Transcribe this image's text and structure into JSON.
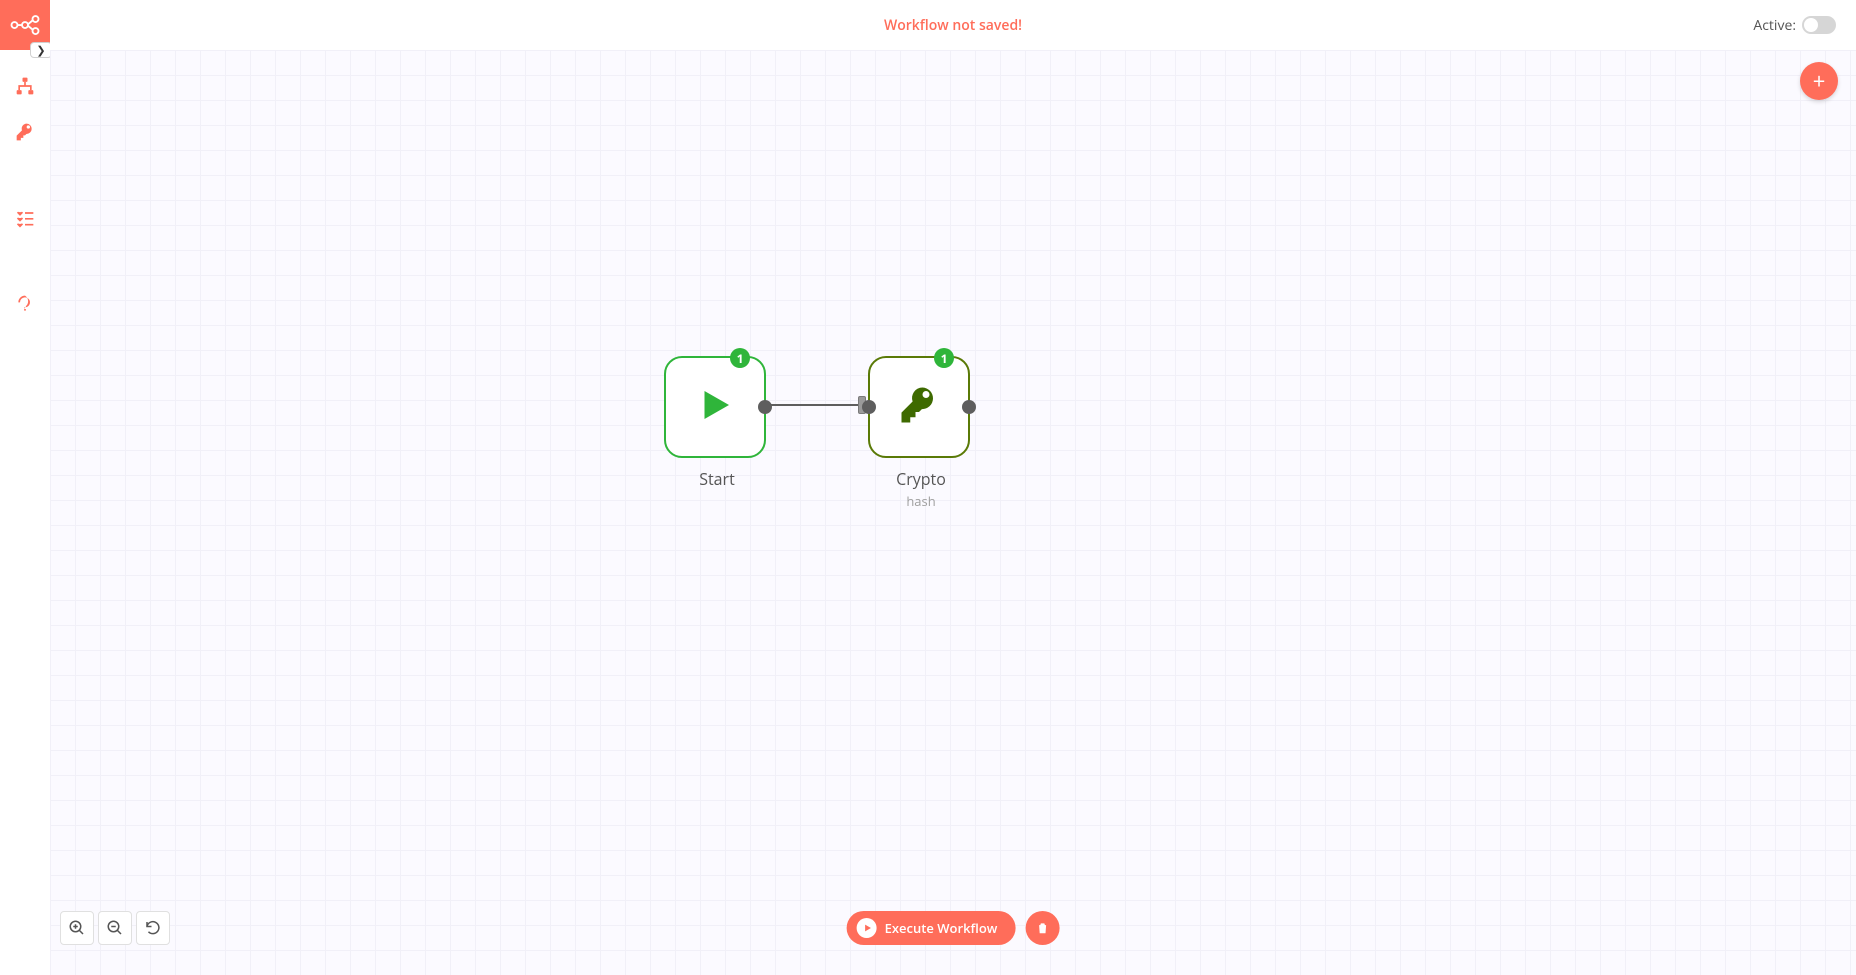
{
  "header": {
    "banner": "Workflow not saved!",
    "active_label": "Active:"
  },
  "toolbar": {
    "execute": "Execute Workflow"
  },
  "nodes": {
    "start": {
      "label": "Start",
      "count": "1"
    },
    "crypto": {
      "label": "Crypto",
      "sub": "hash",
      "count": "1"
    }
  },
  "colors": {
    "accent": "#ff6d5a"
  }
}
